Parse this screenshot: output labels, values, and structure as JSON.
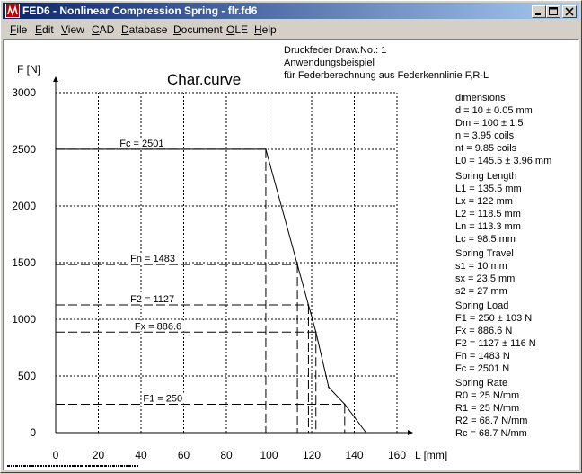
{
  "window": {
    "title": "FED6 - Nonlinear Compression Spring  -  flr.fd6",
    "icon": "fed6-app-icon",
    "controls": [
      "minimize",
      "maximize",
      "close"
    ]
  },
  "menu": [
    {
      "label": "File",
      "u": "F",
      "rest": "ile"
    },
    {
      "label": "Edit",
      "u": "E",
      "rest": "dit"
    },
    {
      "label": "View",
      "u": "V",
      "rest": "iew"
    },
    {
      "label": "CAD",
      "u": "C",
      "rest": "AD"
    },
    {
      "label": "Database",
      "u": "D",
      "rest": "atabase"
    },
    {
      "label": "Document",
      "u": "D",
      "rest": "ocument"
    },
    {
      "label": "OLE",
      "u": "O",
      "rest": "LE"
    },
    {
      "label": "Help",
      "u": "H",
      "rest": "elp"
    }
  ],
  "header": {
    "line1": "Druckfeder   Draw.No.: 1",
    "line2": "Anwendungsbeispiel",
    "line3": "für Federberechnung aus Federkennlinie F,R-L"
  },
  "chart_data": {
    "type": "line",
    "title": "Char.curve",
    "xlabel": "L [mm]",
    "ylabel": "F [N]",
    "xlim": [
      0,
      160
    ],
    "ylim": [
      0,
      3000
    ],
    "xticks": [
      0,
      20,
      40,
      60,
      80,
      100,
      120,
      140,
      160
    ],
    "yticks": [
      0,
      500,
      1000,
      1500,
      2000,
      2500,
      3000
    ],
    "grid": true,
    "series": [
      {
        "x": [
          98.5,
          113.3,
          118.5,
          122,
          128,
          135.5,
          145.5
        ],
        "y": [
          2501,
          1483,
          1127,
          886.6,
          400,
          250,
          0
        ]
      }
    ],
    "markers": [
      {
        "label": "Fc = 2501",
        "L": 98.5,
        "F": 2501,
        "label_x": 30
      },
      {
        "label": "Fn = 1483",
        "L": 113.3,
        "F": 1483,
        "label_x": 35
      },
      {
        "label": "F2 = 1127",
        "L": 118.5,
        "F": 1127,
        "label_x": 35
      },
      {
        "label": "Fx = 886.6",
        "L": 122,
        "F": 886.6,
        "label_x": 37
      },
      {
        "label": "F1 = 250",
        "L": 135.5,
        "F": 250,
        "label_x": 41
      }
    ]
  },
  "dimensions": {
    "heading": "dimensions",
    "items": [
      "d = 10 ± 0.05 mm",
      "Dm = 100 ± 1.5",
      "n  = 3.95 coils",
      "nt = 9.85 coils",
      "L0 = 145.5 ± 3.96 mm"
    ]
  },
  "spring_length": {
    "heading": "Spring Length",
    "items": [
      "L1 = 135.5 mm",
      "Lx = 122 mm",
      "L2 = 118.5 mm",
      "Ln = 113.3 mm",
      "Lc = 98.5 mm"
    ]
  },
  "spring_travel": {
    "heading": "Spring Travel",
    "items": [
      "s1 = 10 mm",
      "sx = 23.5 mm",
      "s2 = 27 mm"
    ]
  },
  "spring_load": {
    "heading": "Spring Load",
    "items": [
      "F1 = 250 ± 103 N",
      "Fx = 886.6 N",
      "F2 = 1127 ± 116 N",
      "Fn = 1483 N",
      "Fc = 2501 N"
    ]
  },
  "spring_rate": {
    "heading": "Spring Rate",
    "items": [
      "R0 = 25 N/mm",
      "R1 = 25 N/mm",
      "R2 = 68.7 N/mm",
      "Rc = 68.7 N/mm"
    ]
  }
}
